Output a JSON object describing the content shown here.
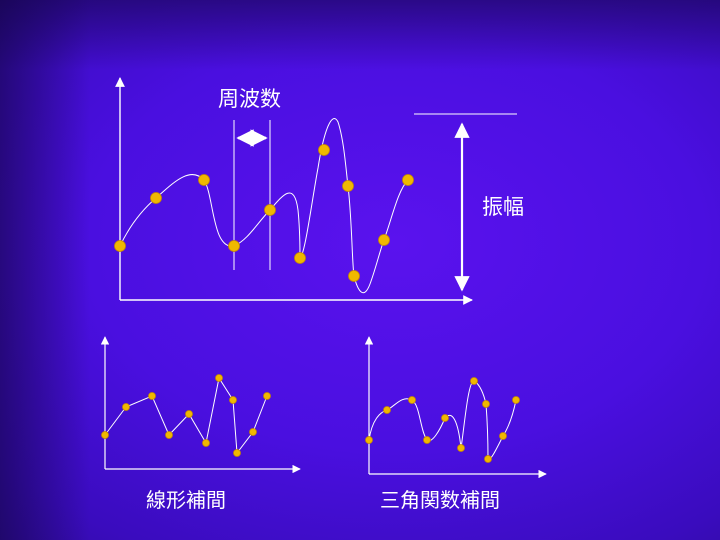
{
  "labels": {
    "frequency": "周波数",
    "amplitude": "振幅",
    "linear": "線形補間",
    "trig": "三角関数補間"
  },
  "colors": {
    "point": "#f0b800",
    "point_edge": "#c78a00",
    "line": "#ffffff"
  }
}
